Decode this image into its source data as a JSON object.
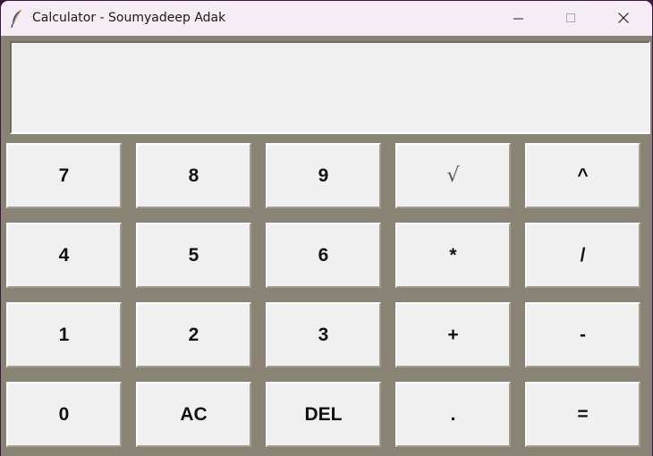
{
  "window": {
    "title": "Calculator - Soumyadeep Adak",
    "app_icon": "feather-icon",
    "controls": [
      "minimize-icon",
      "maximize-icon",
      "close-icon"
    ]
  },
  "display": {
    "value": ""
  },
  "keypad": {
    "rows": [
      [
        "7",
        "8",
        "9",
        "√",
        "^"
      ],
      [
        "4",
        "5",
        "6",
        "*",
        "/"
      ],
      [
        "1",
        "2",
        "3",
        "+",
        "-"
      ],
      [
        "0",
        "AC",
        "DEL",
        ".",
        "="
      ]
    ]
  },
  "colors": {
    "window_background": "#898375",
    "button_face": "#f0f0f0",
    "titlebar": "#f6ecf6"
  }
}
